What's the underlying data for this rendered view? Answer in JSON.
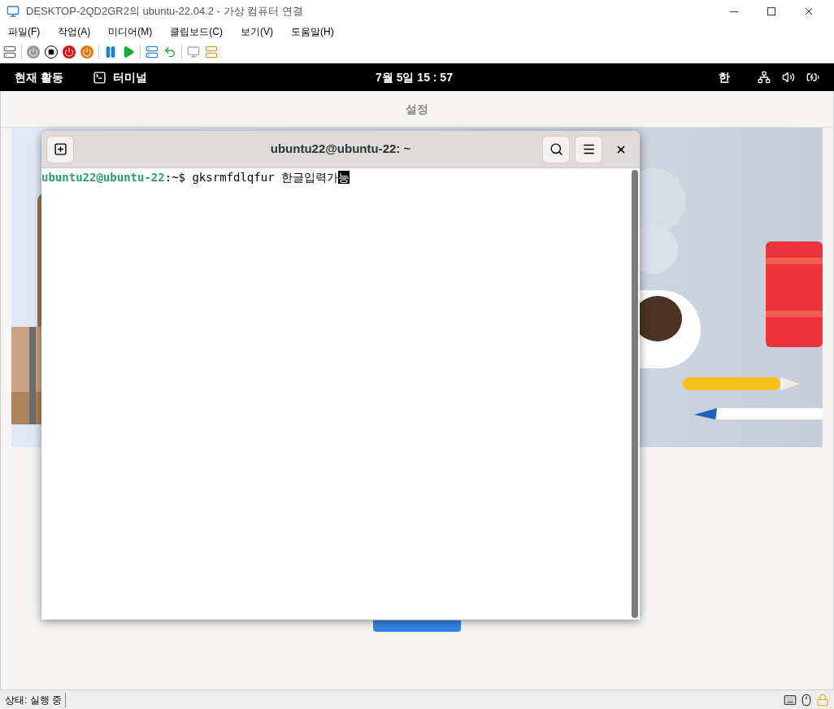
{
  "window": {
    "title": "DESKTOP-2QD2GR2의 ubuntu-22.04.2 - 가상 컴퓨터 연결"
  },
  "menu": [
    "파일(F)",
    "작업(A)",
    "미디어(M)",
    "클립보드(C)",
    "보기(V)",
    "도움말(H)"
  ],
  "top_bar": {
    "activities": "현재 활동",
    "app": "터미널",
    "clock": "7월 5일 15 : 57",
    "input_method": "한"
  },
  "settings": {
    "title": "설정"
  },
  "terminal": {
    "title": "ubuntu22@ubuntu-22: ~",
    "prompt_user": "ubuntu22@ubuntu-22",
    "prompt_path": ":~$ ",
    "command": "gksrmfdlqfur 한글입력가",
    "cursor_char": "능"
  },
  "status_bar": {
    "state": "상태: 실행 중"
  }
}
